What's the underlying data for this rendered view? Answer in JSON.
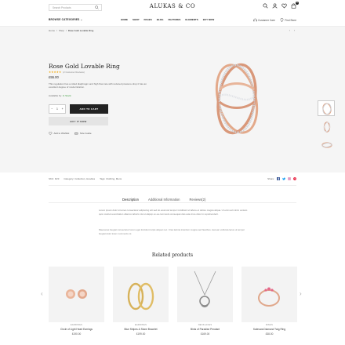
{
  "header": {
    "search_placeholder": "Search Products",
    "logo": "ALUKAS & CO",
    "cart_count": "0",
    "browse_label": "BROWSE CATEGORIES",
    "menu": [
      "HOME",
      "SHOP",
      "PAGES",
      "BLOG",
      "FEATURES",
      "ELEMENTS",
      "BUY NOW"
    ],
    "customer_care": "Customer Care",
    "find_store": "Find Store"
  },
  "breadcrumb": [
    "Home",
    "Shop",
    "Rose Gold Lovable Ring"
  ],
  "pager": "‹ ›",
  "product": {
    "title": "Rose Gold Lovable Ring",
    "stars": "★★★★★",
    "reviews": "(2 Customer Reviews)",
    "price": "£55.00",
    "description": "This regulation has a rolled diaphragm and high flow rate with reduced pressure drop it has an excellent degree of modernization.",
    "availability_label": "Available by:",
    "availability_value": "In Stock",
    "qty": "1",
    "qty_minus": "−",
    "qty_plus": "+",
    "add_to_cart": "ADD TO CART",
    "buy_now": "BUY IT NOW",
    "wishlist": "Add to Wishlist",
    "size_guide": "Size Guide"
  },
  "meta": {
    "sku_label": "SKU:",
    "sku": "D23",
    "category_label": "Category:",
    "categories": "Collection, Hoodies",
    "tags_label": "Tags:",
    "tags": "Clothing, Mens",
    "share": "Share:"
  },
  "tabs": [
    "Description",
    "Additional Information",
    "Reviews(2)"
  ],
  "description_paras": [
    "Lorem ipsum dolor sit amet consectetur adipiscing elit sed do eiusmod tempor incididunt ut labore et dolore magna aliqua. Ut enim ad minim veniam quis nostrud exercitation ullamco laboris nisi ut aliquip ex ea commodo consequat duis aute irure dolor in reprehenderit.",
    "Maecenas feugiat consectetur lorem eget tincidunt turpis aliquet nec. Cras lacinia interdum magna sed faucibus. Aenean vehicula lacus ut tempor feugiat dolor lorem commodo mi."
  ],
  "related_title": "Related products",
  "related": [
    {
      "category": "EARRINGS",
      "name": "Circle of Light Heart Earrings",
      "price": "£190.00"
    },
    {
      "category": "EARRINGS",
      "name": "Blue Stripes & Stone Bracelet",
      "price": "£199.00"
    },
    {
      "category": "NECKLACES",
      "name": "Birds of Paradise Pendant",
      "price": "£169.00"
    },
    {
      "category": "RINGS",
      "name": "Kalevara Diamond Twig Ring",
      "price": "£38.00"
    }
  ],
  "colors": {
    "accent": "#222222",
    "stock": "#3a9a3a",
    "star": "#f0a500",
    "hero_bg": "#f5f5f5"
  }
}
